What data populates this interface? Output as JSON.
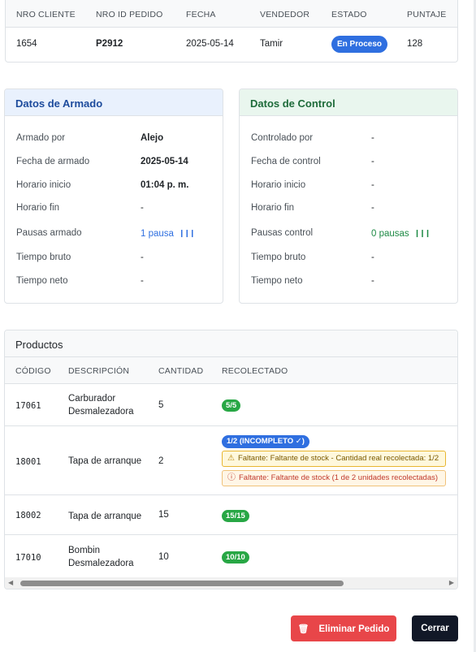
{
  "order": {
    "headers": [
      "NRO CLIENTE",
      "NRO ID PEDIDO",
      "FECHA",
      "VENDEDOR",
      "ESTADO",
      "PUNTAJE"
    ],
    "client_no": "1654",
    "order_id": "P2912",
    "date": "2025-05-14",
    "seller": "Tamir",
    "status": "En Proceso",
    "score": "128"
  },
  "armado": {
    "title": "Datos de Armado",
    "rows": [
      {
        "label": "Armado por",
        "value": "Alejo"
      },
      {
        "label": "Fecha de armado",
        "value": "2025-05-14"
      },
      {
        "label": "Horario inicio",
        "value": "01:04 p. m."
      },
      {
        "label": "Horario fin",
        "value": "-"
      },
      {
        "label": "Pausas armado",
        "value": "1 pausa"
      },
      {
        "label": "Tiempo bruto",
        "value": "-"
      },
      {
        "label": "Tiempo neto",
        "value": "-"
      }
    ]
  },
  "control": {
    "title": "Datos de Control",
    "rows": [
      {
        "label": "Controlado por",
        "value": "-"
      },
      {
        "label": "Fecha de control",
        "value": "-"
      },
      {
        "label": "Horario inicio",
        "value": "-"
      },
      {
        "label": "Horario fin",
        "value": "-"
      },
      {
        "label": "Pausas control",
        "value": "0 pausas"
      },
      {
        "label": "Tiempo bruto",
        "value": "-"
      },
      {
        "label": "Tiempo neto",
        "value": "-"
      }
    ]
  },
  "products": {
    "title": "Productos",
    "headers": [
      "CÓDIGO",
      "DESCRIPCIÓN",
      "CANTIDAD",
      "RECOLECTADO"
    ],
    "rows": [
      {
        "code": "17061",
        "description": "Carburador Desmalezadora",
        "qty": "5",
        "collected": "5/5"
      },
      {
        "code": "18001",
        "description": "Tapa de arranque",
        "qty": "2",
        "collected": "1/2 (INCOMPLETO ✓)",
        "warning": "Faltante: Faltante de stock - Cantidad real recolectada: 1/2",
        "error": "Faltante: Faltante de stock (1 de 2 unidades recolectadas)"
      },
      {
        "code": "18002",
        "description": "Tapa de arranque",
        "qty": "15",
        "collected": "15/15"
      },
      {
        "code": "17010",
        "description": "Bombin Desmalezadora",
        "qty": "10",
        "collected": "10/10"
      }
    ]
  },
  "buttons": {
    "delete": "Eliminar Pedido",
    "close": "Cerrar"
  },
  "icons": {
    "trash": "trash-icon",
    "warning": "warning-triangle-icon",
    "error": "alert-circle-icon",
    "pause": "pause-bars-icon"
  },
  "colors": {
    "status_blue": "#2f6fe0",
    "success_green": "#28a745",
    "danger_red": "#e84649",
    "dark_button": "#111827"
  }
}
